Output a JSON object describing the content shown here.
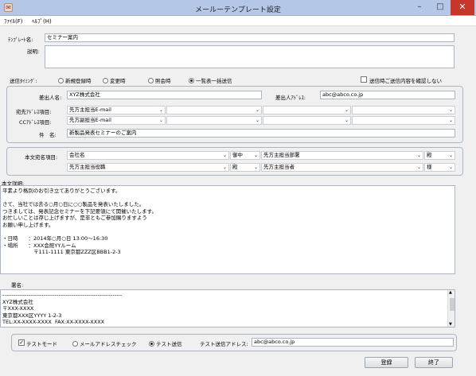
{
  "window": {
    "title": "メールーテンプレート設定",
    "icon": "app-icon",
    "minimize": "–",
    "maximize": "□",
    "close": "✕"
  },
  "menu": [
    "ﾌｧｲﾙ(F)",
    "ﾍﾙﾌﾟ(H)"
  ],
  "template_name": {
    "label": "ﾃﾝﾌﾟﾚｰﾄ名:",
    "value": "セミナー案内"
  },
  "description": {
    "label": "説明:",
    "value": ""
  },
  "send_timing": {
    "label": "送信ﾀｲﾐﾝｸﾞ:",
    "options": [
      "新規登録時",
      "変更時",
      "照会時",
      "一覧表一括送信"
    ],
    "selected": 3,
    "confirm_label": "送信時ご送信内容を確認しない",
    "confirm_checked": false
  },
  "sender": {
    "name_label": "差出人名:",
    "name_value": "XYZ株式会社",
    "address_label": "差出人ｱﾄﾞﾚｽ:",
    "address_value": "abc@abco.co.jp",
    "to_label": "宛先ｱﾄﾞﾚｽ項目:",
    "to_values": [
      "先方主担当E-mail",
      "",
      "",
      ""
    ],
    "cc_label": "CCｱﾄﾞﾚｽ項目:",
    "cc_values": [
      "先方副担当E-mail",
      "",
      "",
      ""
    ],
    "subject_label": "件　名:",
    "subject_value": "新製品発表セミナーのご案内"
  },
  "addressee": {
    "label": "本文宛名項目:",
    "rows": [
      {
        "field1": "会社名",
        "honorific": "御中",
        "field2": "先方主担当部署",
        "suffix": "殿"
      },
      {
        "field1": "先方主担当役職",
        "honorific": "殿",
        "field2": "先方主担当者",
        "suffix": "様"
      }
    ]
  },
  "body": {
    "label": "本文詳細:",
    "lines": [
      "平素より格別のお引き立てありがとうございます。",
      "",
      "さて、当社では去る○月○日に○○製品を発表いたしました。",
      "つきましては、発表記念セミナーを下記要領にて開催いたします。",
      "お忙しいことは存じ上げますが、是非ともご参加賜りますよう",
      "お願い申し上げます。",
      "",
      "・日時　　：2014年○月○日 13:00～16:30",
      "・場所　　：XXX会館YYルーム",
      "　　　　　　〒111-1111 東京都ZZZ区BBB1-2-3"
    ]
  },
  "signature": {
    "label": "署名:",
    "lines": [
      "----------------------------------------------------------------",
      "XYZ株式会社",
      "〒XXX-XXXX",
      "東京都XXX区YYYY 1-2-3",
      "TEL:XX-XXXX-XXXX  FAX:XX-XXXX-XXXX"
    ]
  },
  "test": {
    "mode_label": "テストモード",
    "mode_checked": true,
    "options": [
      "メールアドレスチェック",
      "テスト送信"
    ],
    "selected": 1,
    "address_label": "テスト送信アドレス:",
    "address_value": "abc@abco.co.jp"
  },
  "buttons": {
    "register": "登録",
    "close": "終了"
  },
  "colors": {
    "titlebar": "#b4c7e7",
    "close": "#c7362b",
    "border": "#a9b6c8"
  }
}
